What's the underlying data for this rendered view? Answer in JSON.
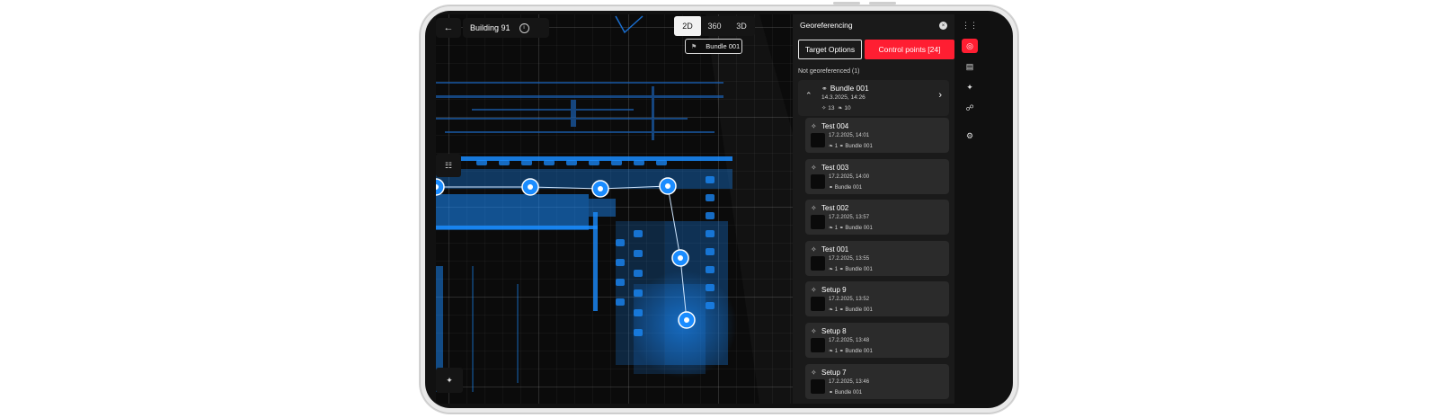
{
  "header": {
    "back_icon": "arrow-left-icon",
    "title": "Building 91",
    "info_icon": "info-icon"
  },
  "view_modes": [
    {
      "label": "2D",
      "active": true
    },
    {
      "label": "360",
      "active": false
    },
    {
      "label": "3D",
      "active": false
    }
  ],
  "map": {
    "bundle_chip": "Bundle 001",
    "point_color": "#1a8cff",
    "tools": [
      "layers-icon",
      "pin-tool-icon"
    ]
  },
  "panel": {
    "title": "Georeferencing",
    "tab_target": "Target Options",
    "tab_control": "Control points [24]",
    "group_label": "Not georeferenced (1)",
    "bundle": {
      "name": "Bundle 001",
      "date": "14.3.2025, 14:26",
      "setups": "13",
      "pins": "10"
    },
    "items": [
      {
        "name": "Test 004",
        "date": "17.2.2025, 14:01",
        "pins": "1",
        "bundle": "Bundle 001"
      },
      {
        "name": "Test 003",
        "date": "17.2.2025, 14:00",
        "pins": "",
        "bundle": "Bundle 001"
      },
      {
        "name": "Test 002",
        "date": "17.2.2025, 13:57",
        "pins": "1",
        "bundle": "Bundle 001"
      },
      {
        "name": "Test 001",
        "date": "17.2.2025, 13:55",
        "pins": "1",
        "bundle": "Bundle 001"
      },
      {
        "name": "Setup 9",
        "date": "17.2.2025, 13:52",
        "pins": "1",
        "bundle": "Bundle 001"
      },
      {
        "name": "Setup 8",
        "date": "17.2.2025, 13:48",
        "pins": "1",
        "bundle": "Bundle 001"
      },
      {
        "name": "Setup 7",
        "date": "17.2.2025, 13:46",
        "pins": "",
        "bundle": "Bundle 001"
      }
    ]
  },
  "accent_color": "#ff1e32",
  "rail_icons": [
    "grid-icon",
    "globe-icon",
    "box-icon",
    "pin-icon",
    "link-icon",
    "settings-icon"
  ]
}
